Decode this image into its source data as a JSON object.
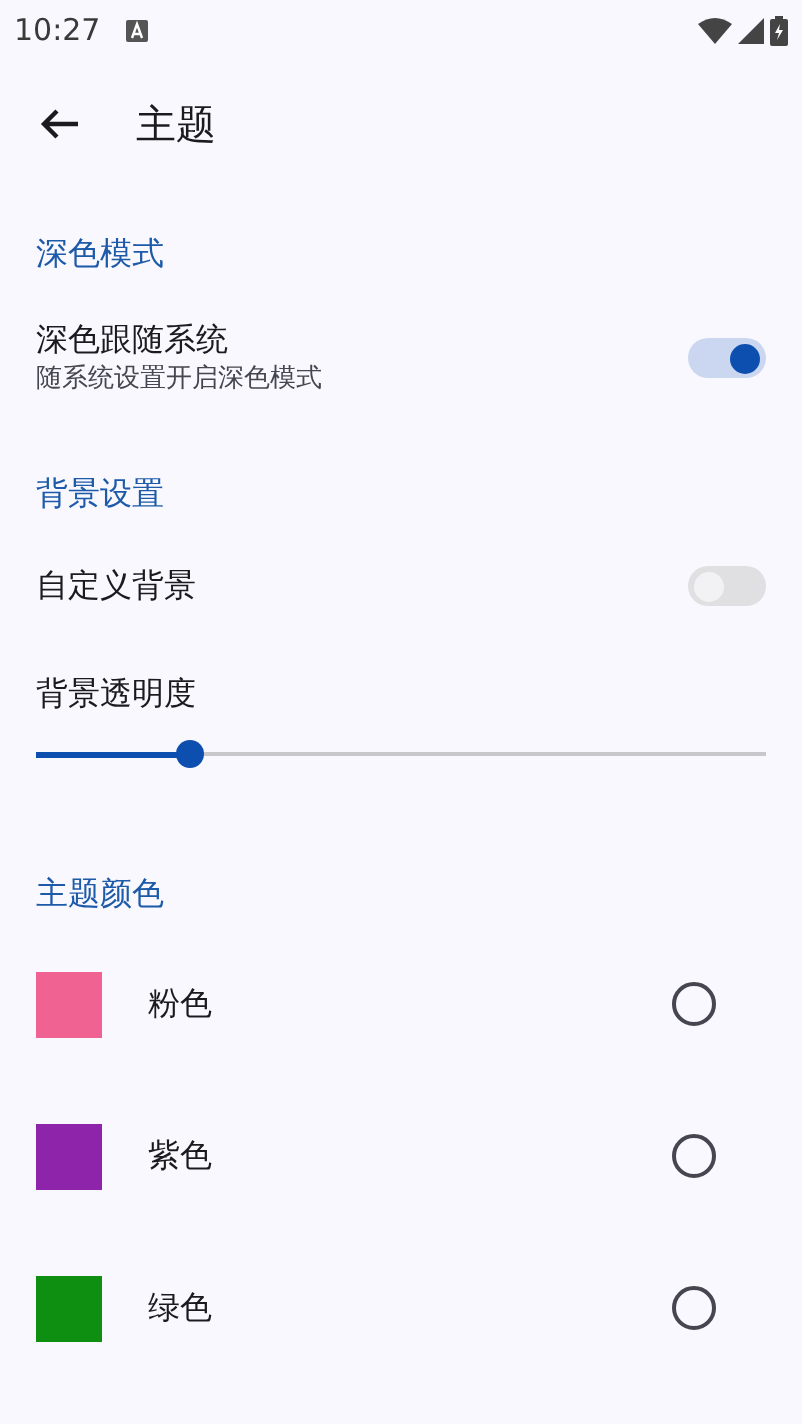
{
  "status_bar": {
    "time": "10:27"
  },
  "app_bar": {
    "title": "主题"
  },
  "sections": [
    {
      "header": "深色模式",
      "items": [
        {
          "kind": "switch",
          "label": "深色跟随系统",
          "subtitle": "随系统设置开启深色模式",
          "on": true
        }
      ]
    },
    {
      "header": "背景设置",
      "items": [
        {
          "kind": "switch",
          "label": "自定义背景",
          "on": false
        },
        {
          "kind": "slider",
          "label": "背景透明度",
          "level": 0.21
        }
      ]
    },
    {
      "header": "主题颜色",
      "items": [
        {
          "kind": "color",
          "label": "粉色",
          "color": "#f06292",
          "selected": false
        },
        {
          "kind": "color",
          "label": "紫色",
          "color": "#8e24aa",
          "selected": false
        },
        {
          "kind": "color",
          "label": "绿色",
          "color": "#0e8f12",
          "selected": false
        }
      ]
    }
  ]
}
